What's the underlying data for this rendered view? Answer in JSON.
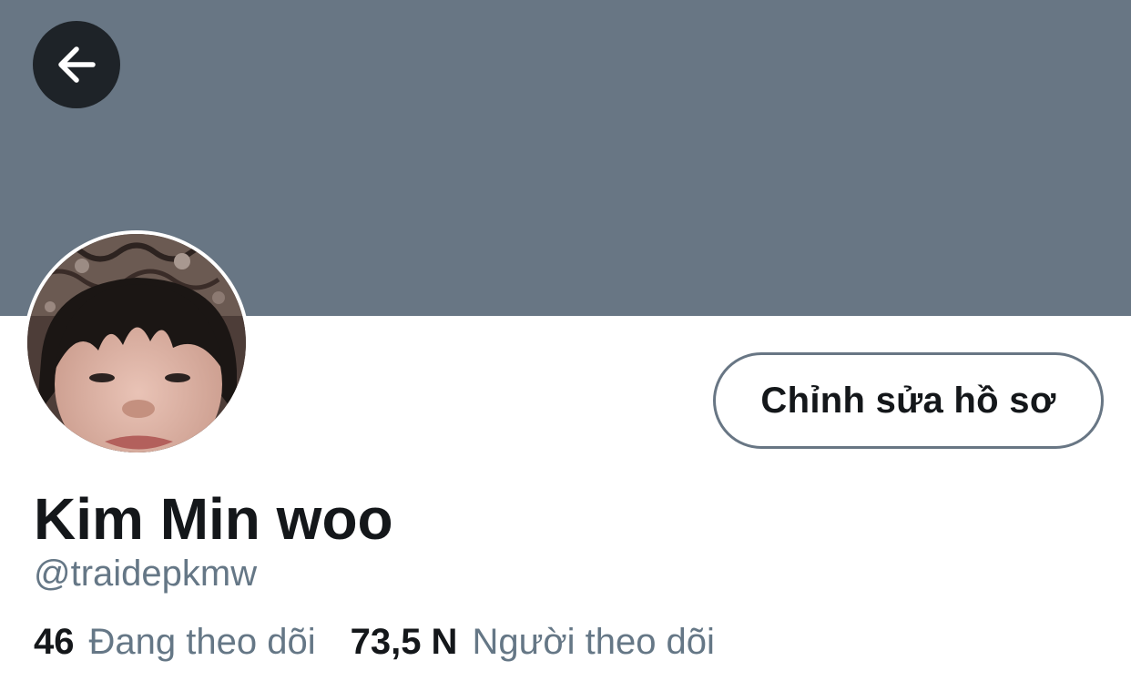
{
  "profile": {
    "display_name": "Kim Min woo",
    "handle": "@traidepkmw",
    "edit_button_label": "Chỉnh sửa hồ sơ"
  },
  "stats": {
    "following_count": "46",
    "following_label": "Đang theo dõi",
    "followers_count": "73,5 N",
    "followers_label": "Người theo dõi"
  },
  "icons": {
    "back": "arrow-left-icon",
    "avatar": "profile-photo"
  },
  "colors": {
    "banner": "#687684",
    "back_button_bg": "#1e2328",
    "primary_text": "#14171a",
    "secondary_text": "#657786",
    "button_border": "#687684"
  }
}
